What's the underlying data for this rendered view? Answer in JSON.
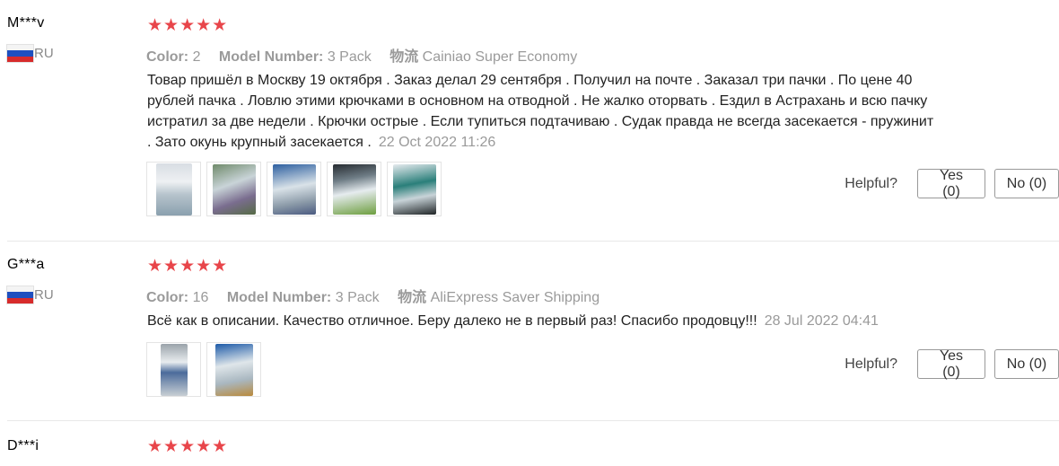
{
  "reviews": [
    {
      "user": "M***v",
      "country": "RU",
      "stars": "★★★★★",
      "color_label": "Color:",
      "color_value": "2",
      "model_label": "Model Number:",
      "model_value": "3 Pack",
      "shipping_label": "物流",
      "shipping_value": "Cainiao Super Economy",
      "text": "Товар пришёл в Москву 19 октября . Заказ делал 29 сентября . Получил на почте . Заказал три пачки . По цене 40 рублей пачка . Ловлю этими крючками в основном на отводной . Не жалко оторвать . Ездил в Астрахань и всю пачку истратил за две недели . Крючки острые . Если тупиться подтачиваю . Судак правда не всегда засекается - пружинит . Зато окунь крупный засекается .",
      "date": "22 Oct 2022 11:26",
      "helpful_label": "Helpful?",
      "yes_label": "Yes (0)",
      "no_label": "No (0)"
    },
    {
      "user": "G***a",
      "country": "RU",
      "stars": "★★★★★",
      "color_label": "Color:",
      "color_value": "16",
      "model_label": "Model Number:",
      "model_value": "3 Pack",
      "shipping_label": "物流",
      "shipping_value": "AliExpress Saver Shipping",
      "text": "Всё как в описании. Качество отличное. Беру далеко не в первый раз! Спасибо продовцу!!!",
      "date": "28 Jul 2022 04:41",
      "helpful_label": "Helpful?",
      "yes_label": "Yes (0)",
      "no_label": "No (0)"
    },
    {
      "user": "D***i",
      "stars": "★★★★★"
    }
  ],
  "colors": {
    "star": "#e8454a",
    "meta_gray": "#9a9a9a"
  }
}
